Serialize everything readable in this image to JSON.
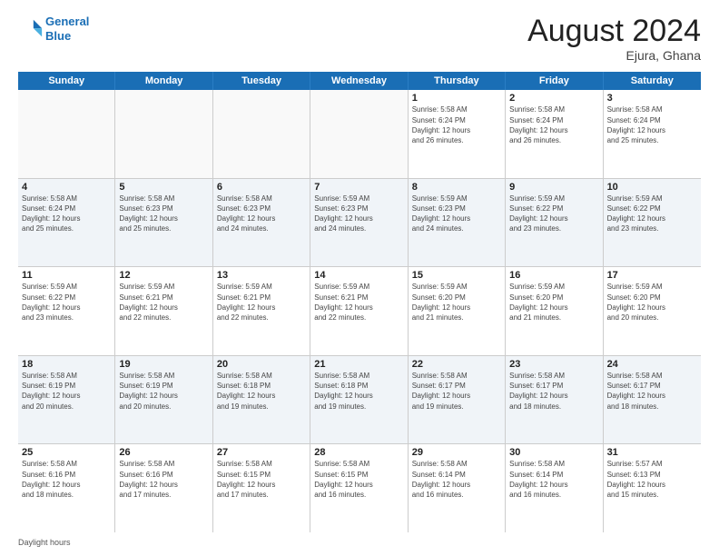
{
  "header": {
    "logo_line1": "General",
    "logo_line2": "Blue",
    "main_title": "August 2024",
    "subtitle": "Ejura, Ghana"
  },
  "days_of_week": [
    "Sunday",
    "Monday",
    "Tuesday",
    "Wednesday",
    "Thursday",
    "Friday",
    "Saturday"
  ],
  "footer_text": "Daylight hours",
  "weeks": [
    [
      {
        "num": "",
        "info": ""
      },
      {
        "num": "",
        "info": ""
      },
      {
        "num": "",
        "info": ""
      },
      {
        "num": "",
        "info": ""
      },
      {
        "num": "1",
        "info": "Sunrise: 5:58 AM\nSunset: 6:24 PM\nDaylight: 12 hours\nand 26 minutes."
      },
      {
        "num": "2",
        "info": "Sunrise: 5:58 AM\nSunset: 6:24 PM\nDaylight: 12 hours\nand 26 minutes."
      },
      {
        "num": "3",
        "info": "Sunrise: 5:58 AM\nSunset: 6:24 PM\nDaylight: 12 hours\nand 25 minutes."
      }
    ],
    [
      {
        "num": "4",
        "info": "Sunrise: 5:58 AM\nSunset: 6:24 PM\nDaylight: 12 hours\nand 25 minutes."
      },
      {
        "num": "5",
        "info": "Sunrise: 5:58 AM\nSunset: 6:23 PM\nDaylight: 12 hours\nand 25 minutes."
      },
      {
        "num": "6",
        "info": "Sunrise: 5:58 AM\nSunset: 6:23 PM\nDaylight: 12 hours\nand 24 minutes."
      },
      {
        "num": "7",
        "info": "Sunrise: 5:59 AM\nSunset: 6:23 PM\nDaylight: 12 hours\nand 24 minutes."
      },
      {
        "num": "8",
        "info": "Sunrise: 5:59 AM\nSunset: 6:23 PM\nDaylight: 12 hours\nand 24 minutes."
      },
      {
        "num": "9",
        "info": "Sunrise: 5:59 AM\nSunset: 6:22 PM\nDaylight: 12 hours\nand 23 minutes."
      },
      {
        "num": "10",
        "info": "Sunrise: 5:59 AM\nSunset: 6:22 PM\nDaylight: 12 hours\nand 23 minutes."
      }
    ],
    [
      {
        "num": "11",
        "info": "Sunrise: 5:59 AM\nSunset: 6:22 PM\nDaylight: 12 hours\nand 23 minutes."
      },
      {
        "num": "12",
        "info": "Sunrise: 5:59 AM\nSunset: 6:21 PM\nDaylight: 12 hours\nand 22 minutes."
      },
      {
        "num": "13",
        "info": "Sunrise: 5:59 AM\nSunset: 6:21 PM\nDaylight: 12 hours\nand 22 minutes."
      },
      {
        "num": "14",
        "info": "Sunrise: 5:59 AM\nSunset: 6:21 PM\nDaylight: 12 hours\nand 22 minutes."
      },
      {
        "num": "15",
        "info": "Sunrise: 5:59 AM\nSunset: 6:20 PM\nDaylight: 12 hours\nand 21 minutes."
      },
      {
        "num": "16",
        "info": "Sunrise: 5:59 AM\nSunset: 6:20 PM\nDaylight: 12 hours\nand 21 minutes."
      },
      {
        "num": "17",
        "info": "Sunrise: 5:59 AM\nSunset: 6:20 PM\nDaylight: 12 hours\nand 20 minutes."
      }
    ],
    [
      {
        "num": "18",
        "info": "Sunrise: 5:58 AM\nSunset: 6:19 PM\nDaylight: 12 hours\nand 20 minutes."
      },
      {
        "num": "19",
        "info": "Sunrise: 5:58 AM\nSunset: 6:19 PM\nDaylight: 12 hours\nand 20 minutes."
      },
      {
        "num": "20",
        "info": "Sunrise: 5:58 AM\nSunset: 6:18 PM\nDaylight: 12 hours\nand 19 minutes."
      },
      {
        "num": "21",
        "info": "Sunrise: 5:58 AM\nSunset: 6:18 PM\nDaylight: 12 hours\nand 19 minutes."
      },
      {
        "num": "22",
        "info": "Sunrise: 5:58 AM\nSunset: 6:17 PM\nDaylight: 12 hours\nand 19 minutes."
      },
      {
        "num": "23",
        "info": "Sunrise: 5:58 AM\nSunset: 6:17 PM\nDaylight: 12 hours\nand 18 minutes."
      },
      {
        "num": "24",
        "info": "Sunrise: 5:58 AM\nSunset: 6:17 PM\nDaylight: 12 hours\nand 18 minutes."
      }
    ],
    [
      {
        "num": "25",
        "info": "Sunrise: 5:58 AM\nSunset: 6:16 PM\nDaylight: 12 hours\nand 18 minutes."
      },
      {
        "num": "26",
        "info": "Sunrise: 5:58 AM\nSunset: 6:16 PM\nDaylight: 12 hours\nand 17 minutes."
      },
      {
        "num": "27",
        "info": "Sunrise: 5:58 AM\nSunset: 6:15 PM\nDaylight: 12 hours\nand 17 minutes."
      },
      {
        "num": "28",
        "info": "Sunrise: 5:58 AM\nSunset: 6:15 PM\nDaylight: 12 hours\nand 16 minutes."
      },
      {
        "num": "29",
        "info": "Sunrise: 5:58 AM\nSunset: 6:14 PM\nDaylight: 12 hours\nand 16 minutes."
      },
      {
        "num": "30",
        "info": "Sunrise: 5:58 AM\nSunset: 6:14 PM\nDaylight: 12 hours\nand 16 minutes."
      },
      {
        "num": "31",
        "info": "Sunrise: 5:57 AM\nSunset: 6:13 PM\nDaylight: 12 hours\nand 15 minutes."
      }
    ]
  ]
}
